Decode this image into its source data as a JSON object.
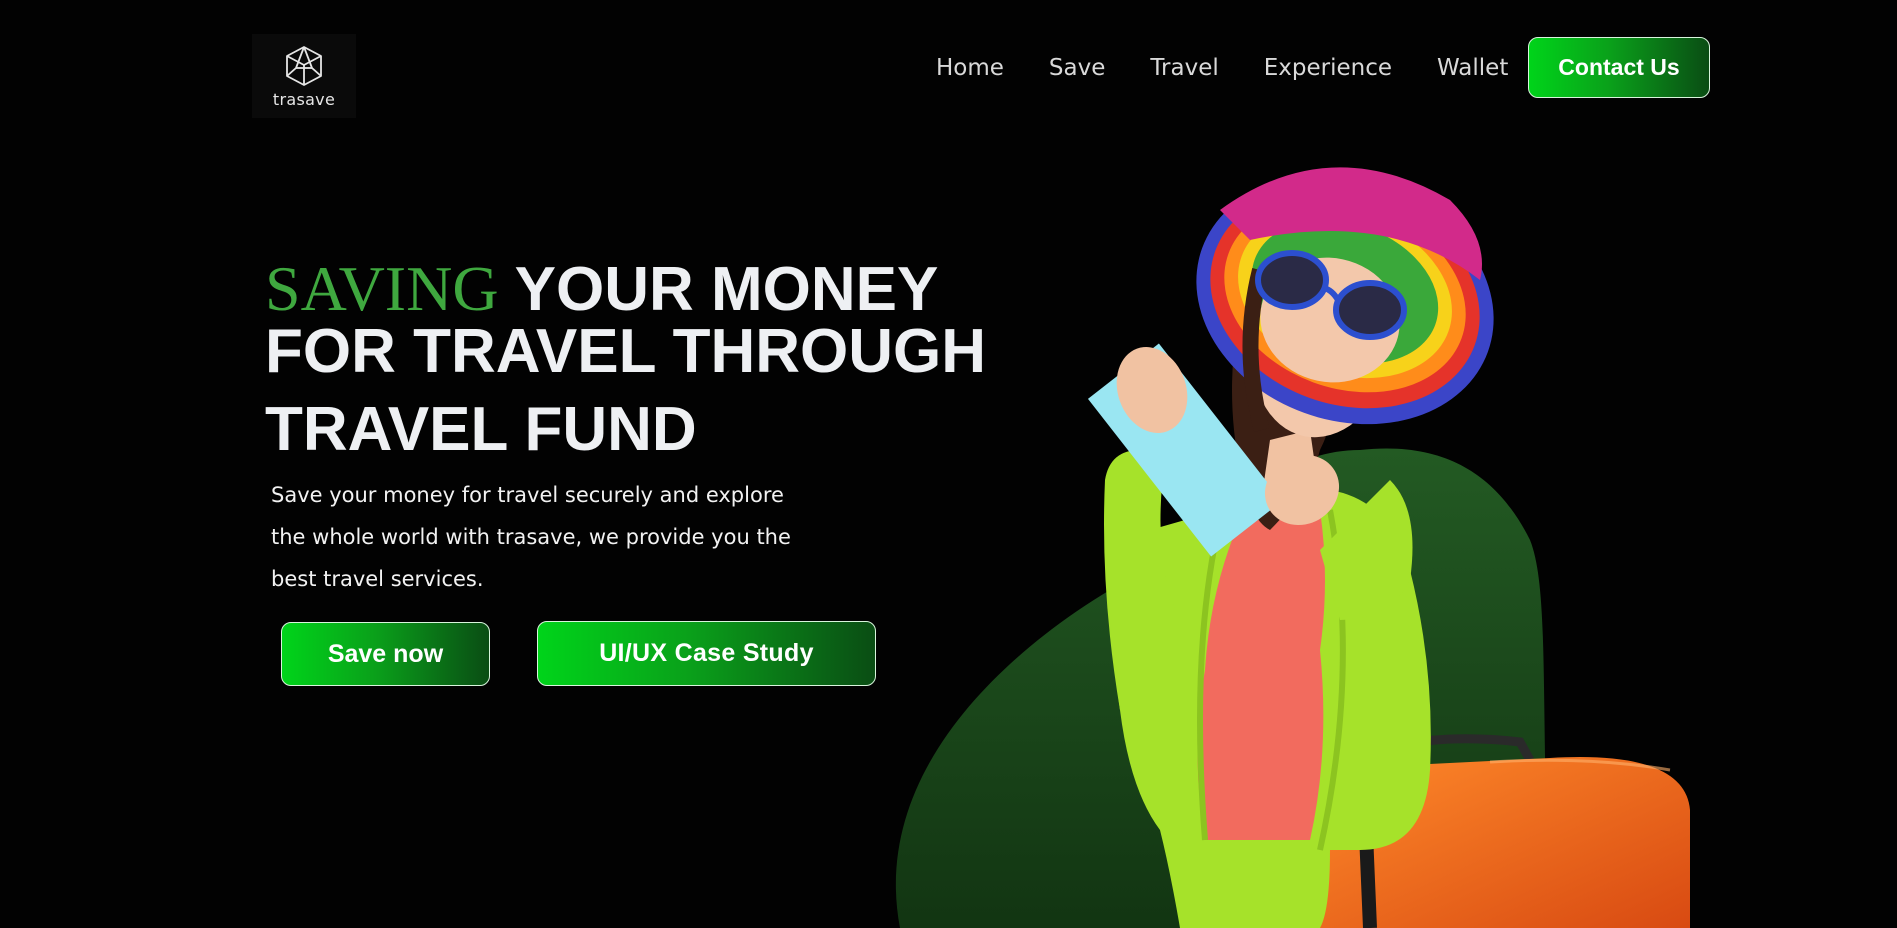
{
  "brand": {
    "name": "trasave",
    "logo_icon": "cube-icon"
  },
  "nav": {
    "items": [
      "Home",
      "Save",
      "Travel",
      "Experience",
      "Wallet"
    ]
  },
  "header": {
    "contact_label": "Contact Us"
  },
  "hero": {
    "headline_accent": "SAVING",
    "headline_rest": "YOUR MONEY",
    "headline_line2": "FOR TRAVEL THROUGH",
    "headline_line3": "TRAVEL FUND",
    "subtext_lines": [
      "Save your money for travel securely and explore",
      "the whole world with trasave, we provide you the",
      "best travel services."
    ],
    "primary_button": "Save now",
    "secondary_button": "UI/UX Case Study",
    "image": "woman-traveler-with-ticket-and-suitcase"
  },
  "colors": {
    "background": "#020202",
    "accent_green": "#3fa83f",
    "button_gradient_start": "#00d41a",
    "button_gradient_end": "#0a4d14",
    "blob_green": "#1f4d1f"
  }
}
